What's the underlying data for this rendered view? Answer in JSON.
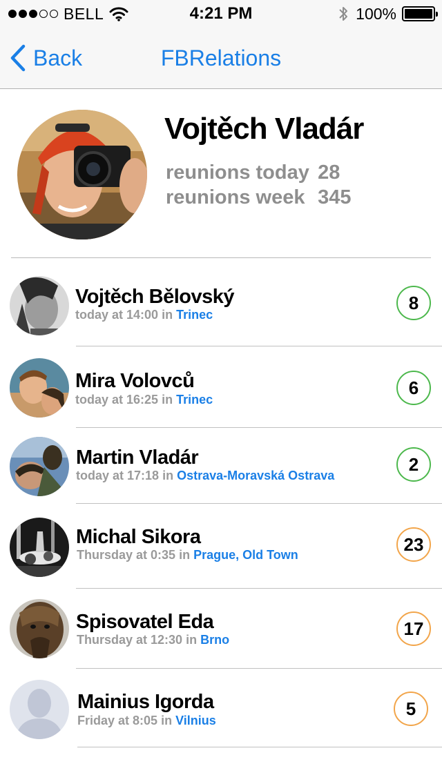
{
  "status_bar": {
    "carrier": "BELL",
    "time": "4:21 PM",
    "battery": "100%",
    "battery_level": 1.0,
    "signal_bars_filled": 3,
    "signal_bars_total": 5
  },
  "nav": {
    "back_label": "Back",
    "title": "FBRelations"
  },
  "profile": {
    "name": "Vojtěch Vladár",
    "today_label": "reunions today",
    "today_value": "28",
    "week_label": "reunions week",
    "week_value": "345"
  },
  "contacts": [
    {
      "name": "Vojtěch Bělovský",
      "when": "today at 14:00",
      "in_word": "in",
      "city": "Trinec",
      "count": "8",
      "status": "green"
    },
    {
      "name": "Mira Volovců",
      "when": "today at 16:25",
      "in_word": "in",
      "city": "Trinec",
      "count": "6",
      "status": "green"
    },
    {
      "name": "Martin Vladár",
      "when": "today at 17:18",
      "in_word": "in",
      "city": "Ostrava-Moravská Ostrava",
      "count": "2",
      "status": "green"
    },
    {
      "name": "Michal Sikora",
      "when": "Thursday at 0:35",
      "in_word": "in",
      "city": "Prague, Old Town",
      "count": "23",
      "status": "orange"
    },
    {
      "name": "Spisovatel Eda",
      "when": "Thursday at 12:30",
      "in_word": "in",
      "city": "Brno",
      "count": "17",
      "status": "orange"
    },
    {
      "name": "Mainius Igorda",
      "when": "Friday at 8:05",
      "in_word": "in",
      "city": "Vilnius",
      "count": "5",
      "status": "orange"
    }
  ],
  "colors": {
    "accent": "#1a7fe6",
    "badge_green": "#4cb84c",
    "badge_orange": "#f2a54a",
    "secondary_text": "#9a9a9a"
  }
}
